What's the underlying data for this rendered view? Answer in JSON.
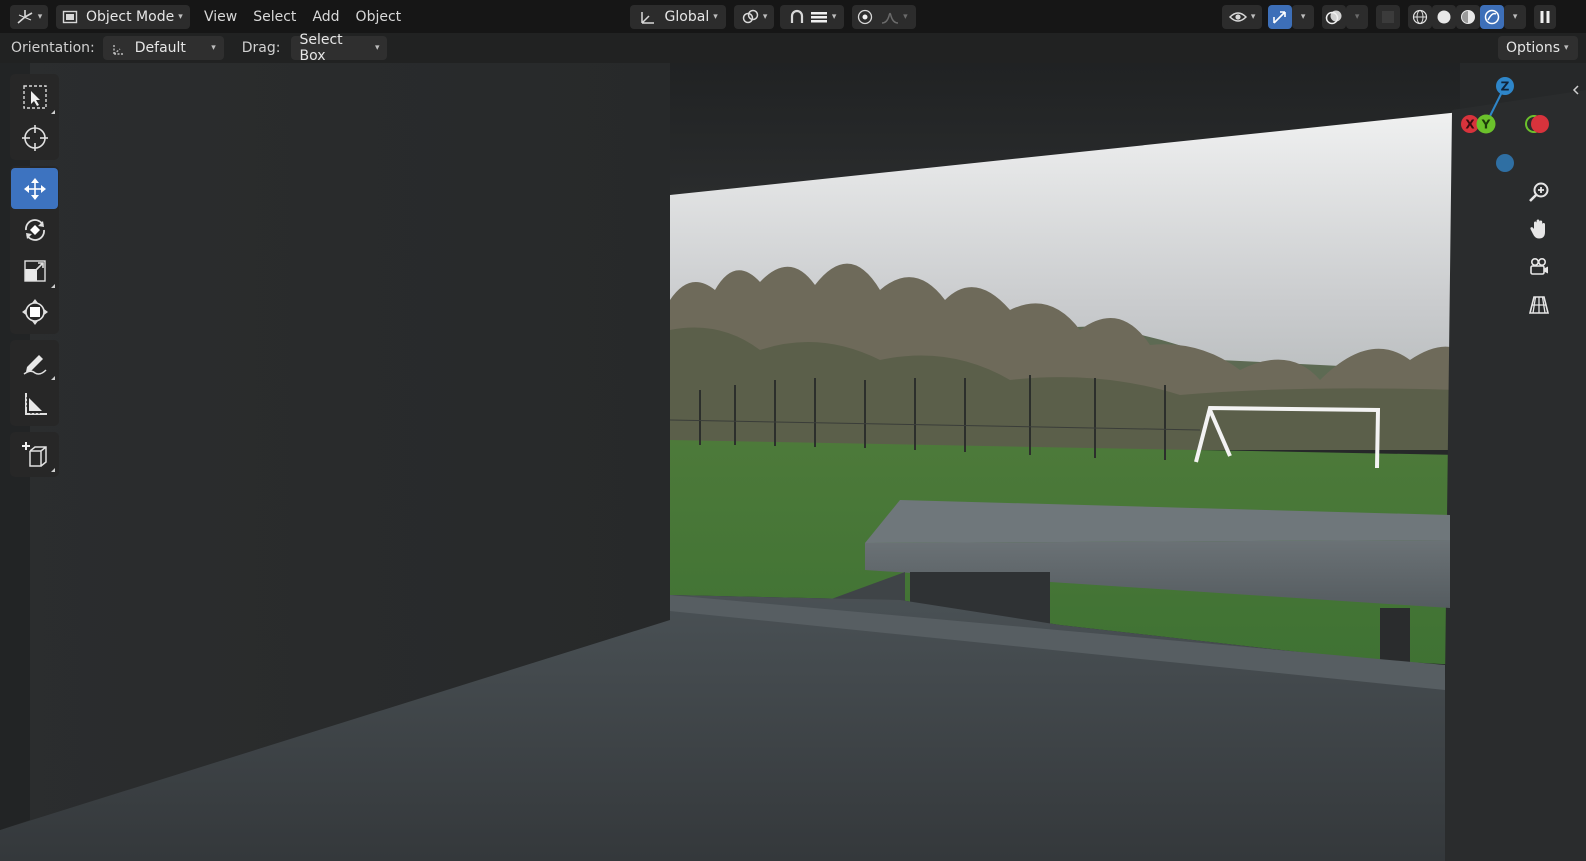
{
  "header": {
    "editor_type_icon": "axes-grid-icon",
    "mode_label": "Object Mode",
    "menus": [
      "View",
      "Select",
      "Add",
      "Object"
    ],
    "transform_orientation": "Global",
    "options_label": "Options"
  },
  "tool_settings": {
    "orientation_label": "Orientation:",
    "orientation_value": "Default",
    "drag_label": "Drag:",
    "drag_value": "Select Box"
  },
  "toolbar": {
    "tools": [
      {
        "name": "select-box",
        "icon": "select-box-icon",
        "active": false
      },
      {
        "name": "cursor",
        "icon": "cursor-crosshair-icon",
        "active": false
      },
      {
        "name": "move",
        "icon": "move-arrows-icon",
        "active": true
      },
      {
        "name": "rotate",
        "icon": "rotate-icon",
        "active": false
      },
      {
        "name": "scale",
        "icon": "scale-icon",
        "active": false
      },
      {
        "name": "transform",
        "icon": "transform-icon",
        "active": false
      },
      {
        "name": "annotate",
        "icon": "annotate-pencil-icon",
        "active": false
      },
      {
        "name": "measure",
        "icon": "measure-ruler-icon",
        "active": false
      },
      {
        "name": "add-cube",
        "icon": "add-cube-icon",
        "active": false
      }
    ]
  },
  "gizmo": {
    "z_label": "Z",
    "y_label": "Y",
    "x_label": "X",
    "x_color": "#d8333c",
    "y_color": "#6bc12b",
    "z_color": "#2e86c9"
  },
  "shading": {
    "active_mode": "rendered"
  },
  "colors": {
    "accent": "#3d73c0",
    "header_bg": "#161616"
  }
}
